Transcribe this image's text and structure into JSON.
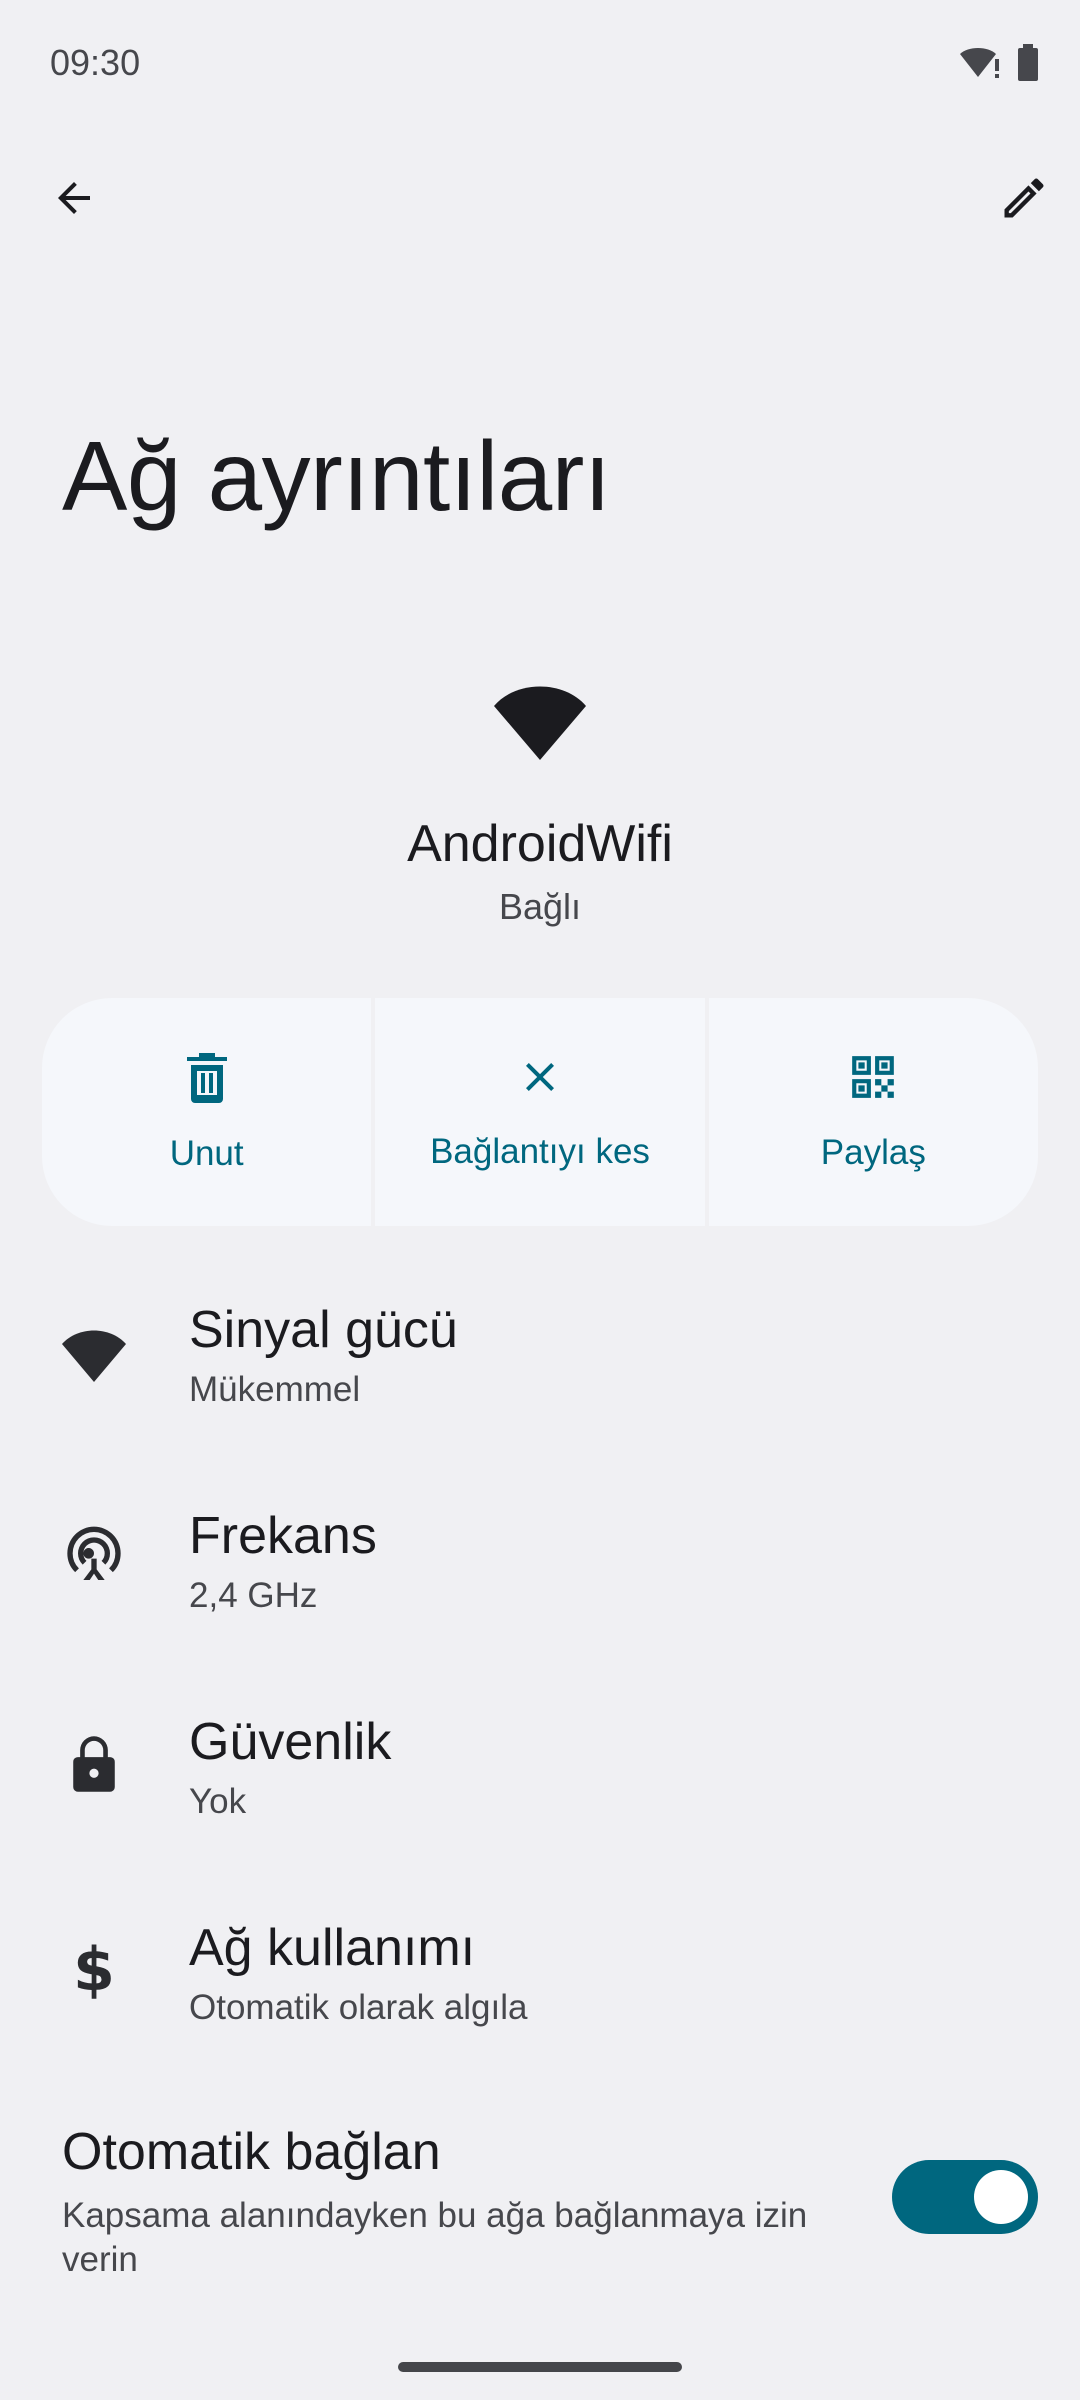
{
  "status_bar": {
    "time": "09:30",
    "icons": [
      "wifi-alert-icon",
      "battery-icon"
    ]
  },
  "app_bar": {
    "back_icon": "arrow-back-icon",
    "edit_icon": "pencil-edit-icon"
  },
  "page_title": "Ağ ayrıntıları",
  "network": {
    "icon": "wifi-icon",
    "name": "AndroidWifi",
    "status": "Bağlı"
  },
  "actions": [
    {
      "label": "Unut",
      "icon": "trash-icon"
    },
    {
      "label": "Bağlantıyı kes",
      "icon": "close-icon"
    },
    {
      "label": "Paylaş",
      "icon": "qr-code-icon"
    }
  ],
  "preferences": [
    {
      "title": "Sinyal gücü",
      "summary": "Mükemmel",
      "icon": "wifi-icon"
    },
    {
      "title": "Frekans",
      "summary": "2,4 GHz",
      "icon": "antenna-icon"
    },
    {
      "title": "Güvenlik",
      "summary": "Yok",
      "icon": "lock-icon"
    },
    {
      "title": "Ağ kullanımı",
      "summary": "Otomatik olarak algıla",
      "icon": "dollar-icon"
    }
  ],
  "auto_connect": {
    "title": "Otomatik bağlan",
    "summary": "Kapsama alanındayken bu ağa bağlanmaya izin verin",
    "enabled": true
  },
  "colors": {
    "accent": "#00677f",
    "background": "#f0f0f3",
    "button_container": "#f5f7fb",
    "text_primary": "#1b1b1f",
    "text_secondary": "#46474c"
  }
}
